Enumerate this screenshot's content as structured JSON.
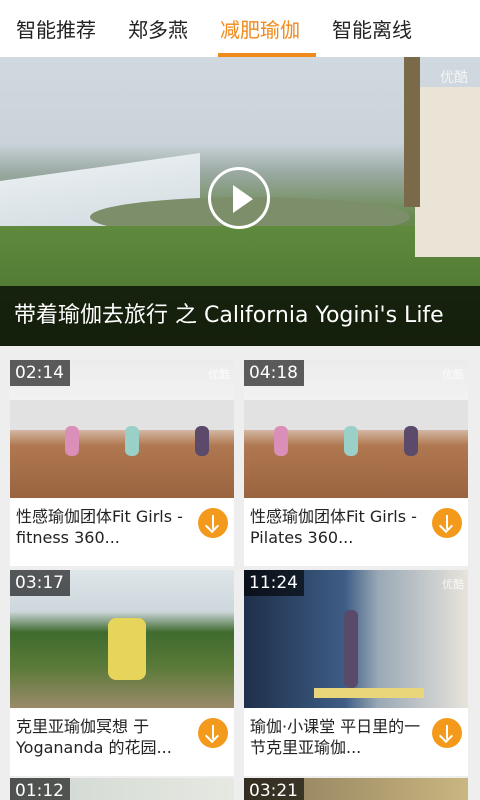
{
  "tabs": [
    "智能推荐",
    "郑多燕",
    "减肥瑜伽",
    "智能离线"
  ],
  "active_tab_index": 2,
  "accent_color": "#f08a1c",
  "hero": {
    "title": "带着瑜伽去旅行 之 California Yogini's Life",
    "watermark": "优酷",
    "play_icon": "play-icon"
  },
  "videos": [
    {
      "duration": "02:14",
      "title": "性感瑜伽团体Fit Girls - fitness 360...",
      "watermark": "优酷"
    },
    {
      "duration": "04:18",
      "title": "性感瑜伽团体Fit Girls - Pilates 360...",
      "watermark": "优酷"
    },
    {
      "duration": "03:17",
      "title": "克里亚瑜伽冥想 于 Yogananda 的花园...",
      "watermark": ""
    },
    {
      "duration": "11:24",
      "title": "瑜伽·小课堂 平日里的一节克里亚瑜伽...",
      "watermark": "优酷"
    }
  ],
  "peek_videos": [
    {
      "duration": "01:12"
    },
    {
      "duration": "03:21"
    }
  ],
  "download_icon": "download-icon"
}
